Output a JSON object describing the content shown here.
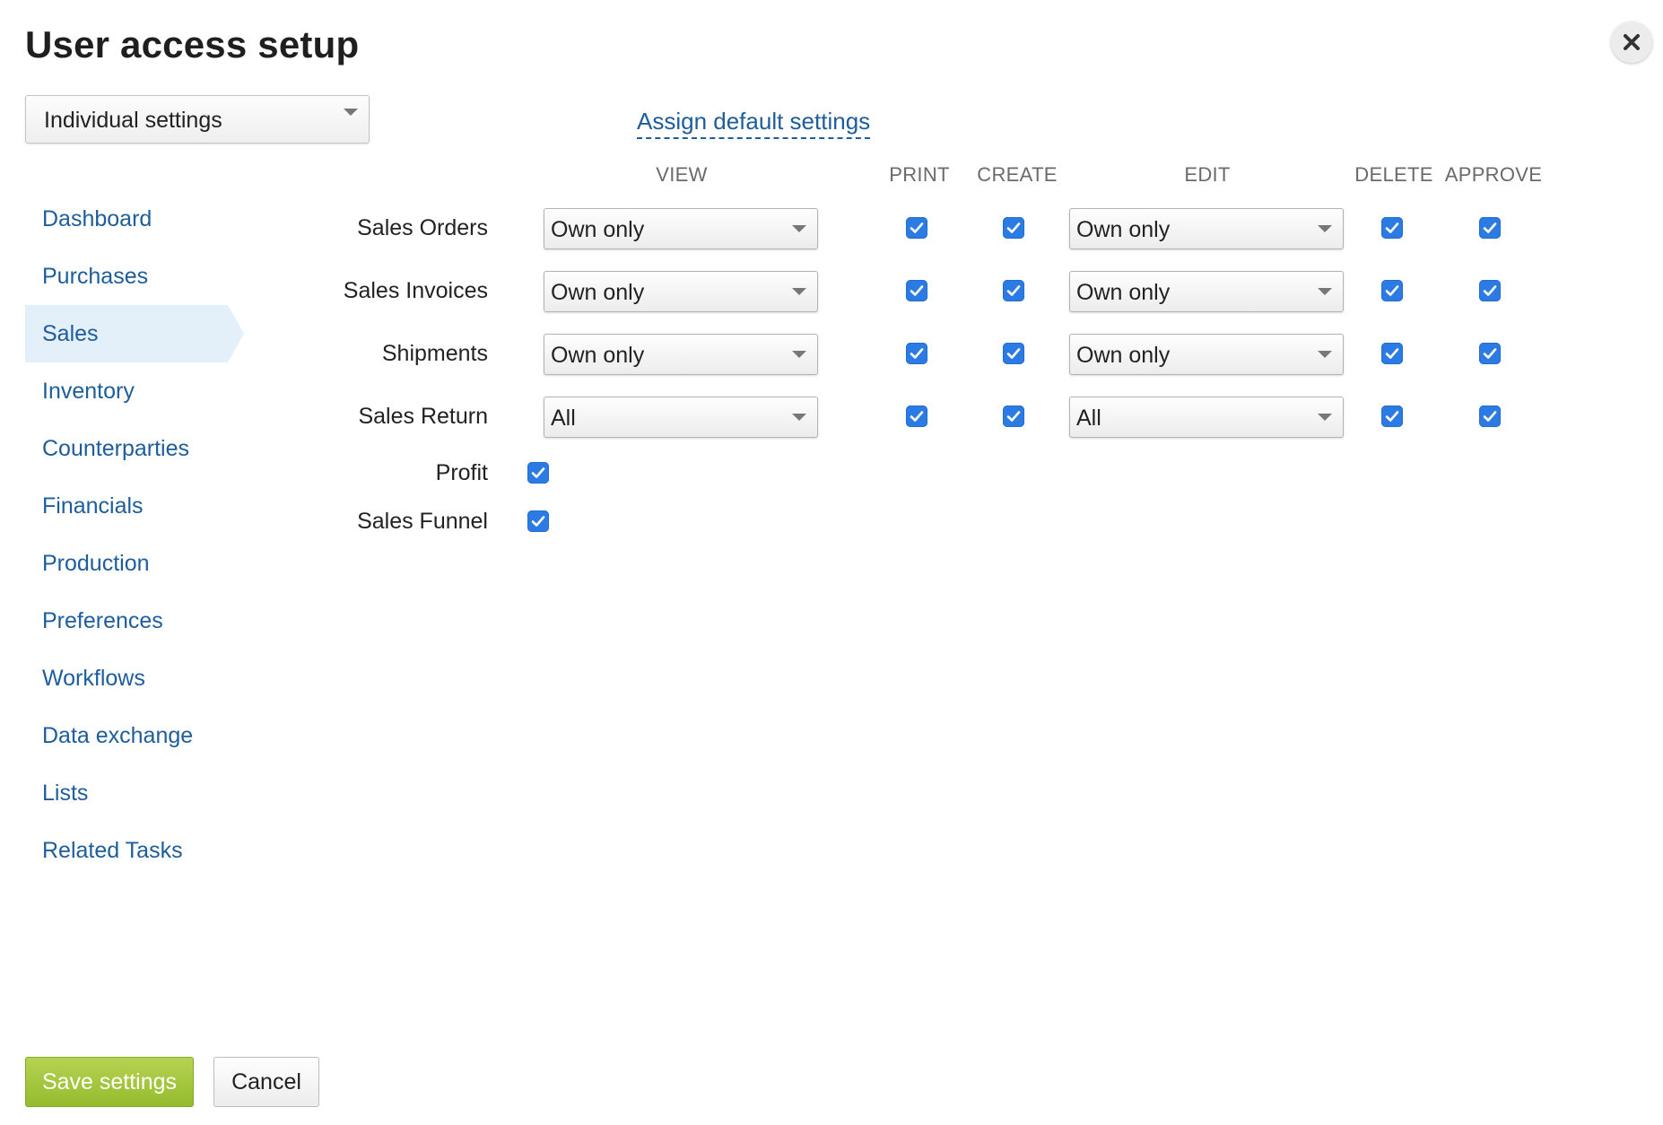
{
  "title": "User access setup",
  "icons": {
    "close": "close-icon",
    "dropdown": "chevron-down-icon",
    "check": "check-icon"
  },
  "profile_select": {
    "value": "Individual settings"
  },
  "assign_link": "Assign default settings",
  "columns": {
    "view": "VIEW",
    "print": "PRINT",
    "create": "CREATE",
    "edit": "EDIT",
    "delete": "DELETE",
    "approve": "APPROVE"
  },
  "sidebar": {
    "active": "Sales",
    "items": [
      {
        "label": "Dashboard"
      },
      {
        "label": "Purchases"
      },
      {
        "label": "Sales"
      },
      {
        "label": "Inventory"
      },
      {
        "label": "Counterparties"
      },
      {
        "label": "Financials"
      },
      {
        "label": "Production"
      },
      {
        "label": "Preferences"
      },
      {
        "label": "Workflows"
      },
      {
        "label": "Data exchange"
      },
      {
        "label": "Lists"
      },
      {
        "label": "Related Tasks"
      }
    ]
  },
  "rows": [
    {
      "label": "Sales Orders",
      "view": "Own only",
      "print": true,
      "create": true,
      "edit": "Own only",
      "delete": true,
      "approve": true
    },
    {
      "label": "Sales Invoices",
      "view": "Own only",
      "print": true,
      "create": true,
      "edit": "Own only",
      "delete": true,
      "approve": true
    },
    {
      "label": "Shipments",
      "view": "Own only",
      "print": true,
      "create": true,
      "edit": "Own only",
      "delete": true,
      "approve": true
    },
    {
      "label": "Sales Return",
      "view": "All",
      "print": true,
      "create": true,
      "edit": "All",
      "delete": true,
      "approve": true
    }
  ],
  "simple_rows": [
    {
      "label": "Profit",
      "enabled": true
    },
    {
      "label": "Sales Funnel",
      "enabled": true
    }
  ],
  "footer": {
    "save_label": "Save settings",
    "cancel_label": "Cancel"
  },
  "colors": {
    "accent": "#1e5d9b",
    "checkbox": "#2c7be5",
    "save": "#a6c63f",
    "active_bg": "#e3eff9"
  }
}
